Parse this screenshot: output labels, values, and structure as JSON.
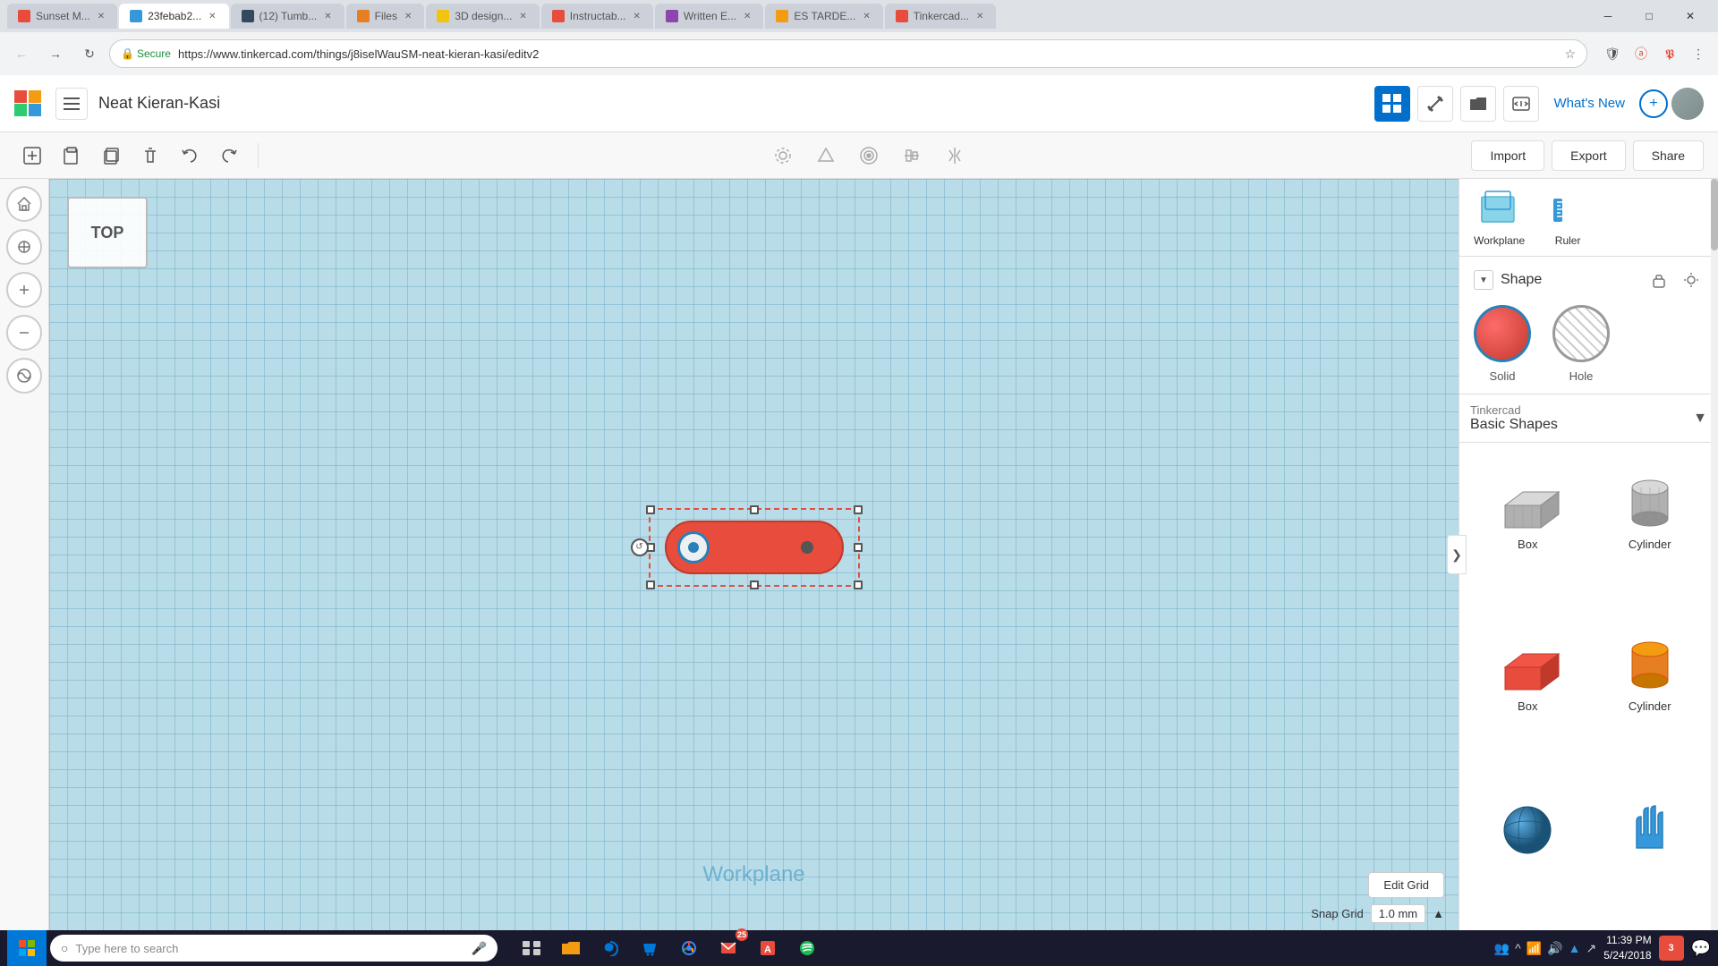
{
  "browser": {
    "tabs": [
      {
        "id": "t1",
        "title": "Sunset M...",
        "active": false,
        "favicon_color": "#e74c3c"
      },
      {
        "id": "t2",
        "title": "23febab2...",
        "active": true,
        "favicon_color": "#3498db"
      },
      {
        "id": "t3",
        "title": "(12) Tumb...",
        "active": false,
        "favicon_color": "#555"
      },
      {
        "id": "t4",
        "title": "Files",
        "active": false,
        "favicon_color": "#e67e22"
      },
      {
        "id": "t5",
        "title": "3D design...",
        "active": false,
        "favicon_color": "#f1c40f"
      },
      {
        "id": "t6",
        "title": "Instructab...",
        "active": false,
        "favicon_color": "#e74c3c"
      },
      {
        "id": "t7",
        "title": "Written E...",
        "active": false,
        "favicon_color": "#8e44ad"
      },
      {
        "id": "t8",
        "title": "ES TARDE...",
        "active": false,
        "favicon_color": "#f39c12"
      },
      {
        "id": "t9",
        "title": "Tinkercad...",
        "active": false,
        "favicon_color": "#e74c3c"
      }
    ],
    "url": "https://www.tinkercad.com/things/j8iselWauSM-neat-kieran-kasi/editv2",
    "secure_label": "Secure"
  },
  "app": {
    "title": "Neat Kieran-Kasi",
    "whats_new_label": "What's New"
  },
  "toolbar": {
    "import_label": "Import",
    "export_label": "Export",
    "share_label": "Share"
  },
  "shape_panel": {
    "title": "Shape",
    "solid_label": "Solid",
    "hole_label": "Hole"
  },
  "library": {
    "source": "Tinkercad",
    "name": "Basic Shapes",
    "shapes": [
      {
        "label": "Box",
        "type": "box-gray"
      },
      {
        "label": "Cylinder",
        "type": "cylinder-gray"
      },
      {
        "label": "Box",
        "type": "box-red"
      },
      {
        "label": "Cylinder",
        "type": "cylinder-orange"
      },
      {
        "label": "",
        "type": "sphere-blue"
      },
      {
        "label": "",
        "type": "hand-blue"
      }
    ]
  },
  "workplane": {
    "label": "Workplane",
    "workplane_tool_label": "Workplane",
    "ruler_tool_label": "Ruler"
  },
  "canvas": {
    "view_label": "TOP",
    "workplane_watermark": "Workplane",
    "edit_grid_label": "Edit Grid",
    "snap_grid_label": "Snap Grid",
    "snap_value": "1.0 mm"
  },
  "taskbar": {
    "search_placeholder": "Type here to search",
    "time": "11:39 PM",
    "date": "5/24/2018",
    "notification_count": "3"
  }
}
